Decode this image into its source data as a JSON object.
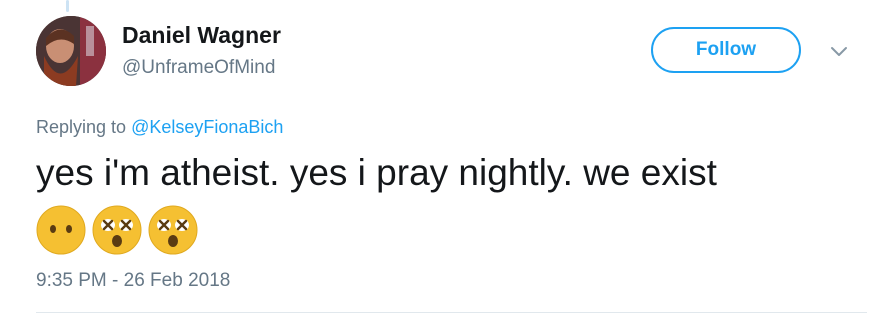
{
  "tweet": {
    "author": {
      "display_name": "Daniel Wagner",
      "handle": "@UnframeOfMind"
    },
    "follow_label": "Follow",
    "reply_prefix": "Replying to",
    "reply_to": "@KelseyFionaBich",
    "text": "yes i'm atheist. yes i pray nightly. we exist",
    "emojis": [
      "face-without-mouth-emoji",
      "dizzy-face-emoji",
      "dizzy-face-emoji"
    ],
    "timestamp": "9:35 PM - 26 Feb 2018"
  },
  "colors": {
    "accent": "#1da1f2",
    "secondary_text": "#657786",
    "primary_text": "#14171a",
    "divider": "#e1e8ed",
    "emoji_face": "#f5c032"
  }
}
